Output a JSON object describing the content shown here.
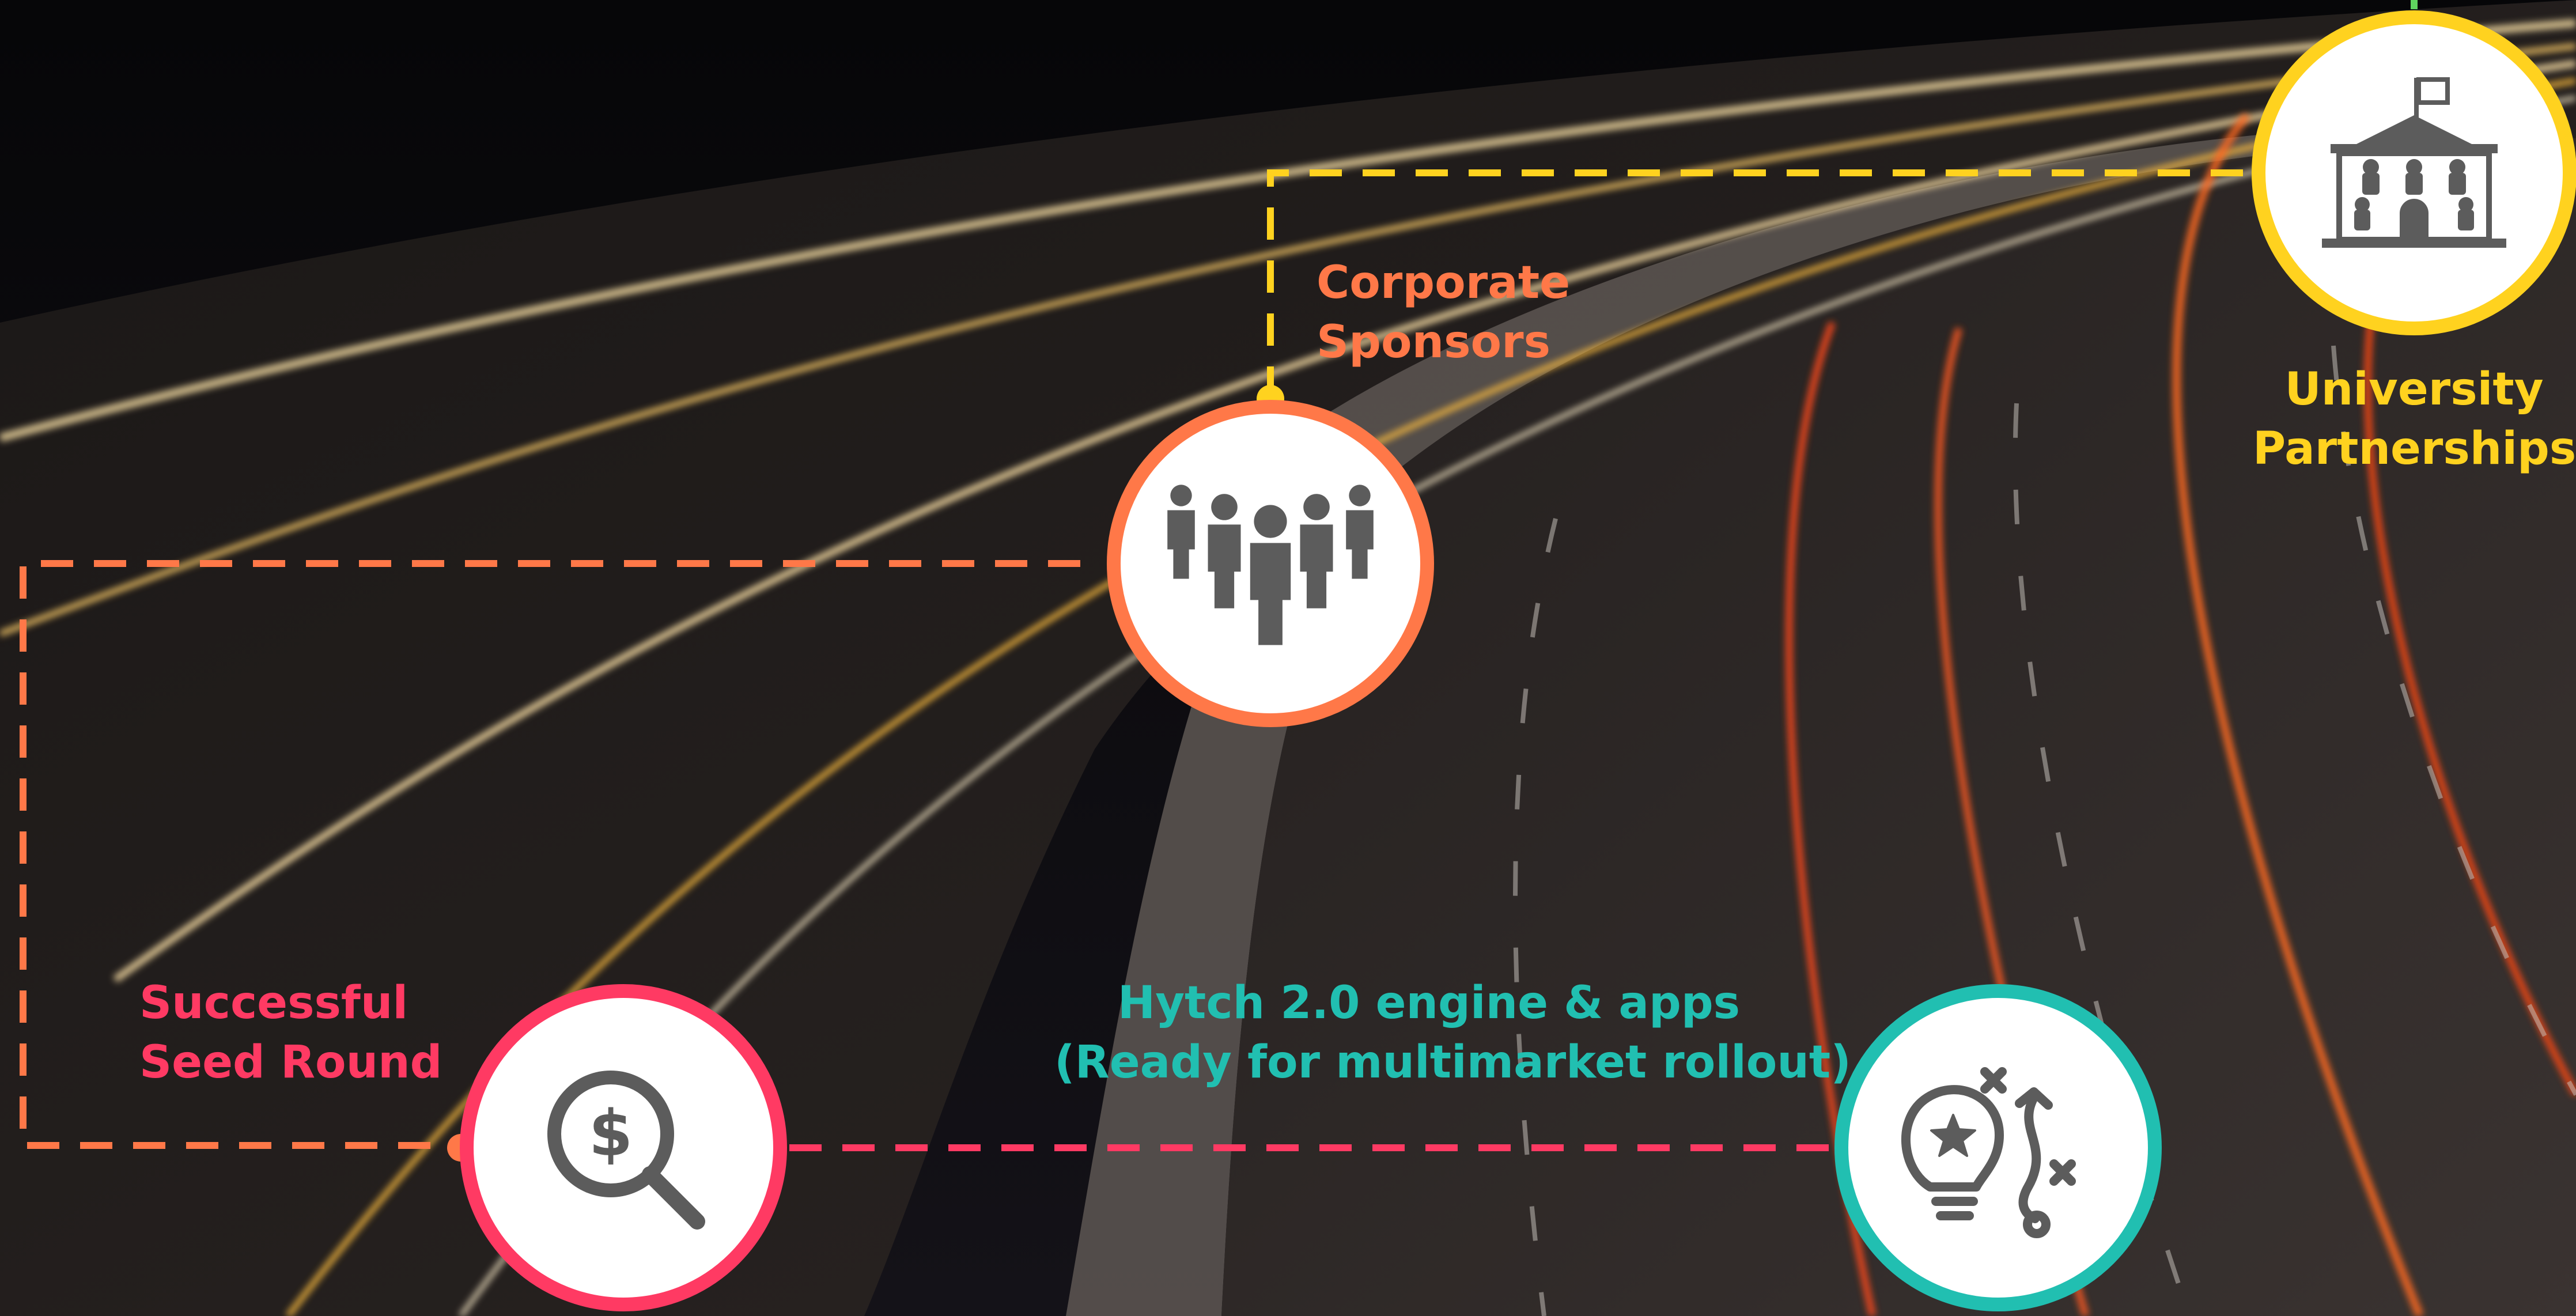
{
  "colors": {
    "yellow": "#ffd21f",
    "orange": "#ff7848",
    "pink": "#ff3a63",
    "teal": "#21bfb1",
    "icon_gray": "#5c5c5c"
  },
  "milestones": {
    "university": {
      "line1": "University",
      "line2": "Partnerships",
      "icon": "university-building-icon"
    },
    "corporate": {
      "line1": "Corporate",
      "line2": "Sponsors",
      "icon": "business-people-group-icon"
    },
    "seed": {
      "line1": "Successful",
      "line2": "Seed Round",
      "icon": "dollar-search-icon"
    },
    "hytch": {
      "line1": "Hytch 2.0 engine & apps",
      "line2": "(Ready for multimarket rollout)",
      "icon": "idea-strategy-icon"
    }
  }
}
